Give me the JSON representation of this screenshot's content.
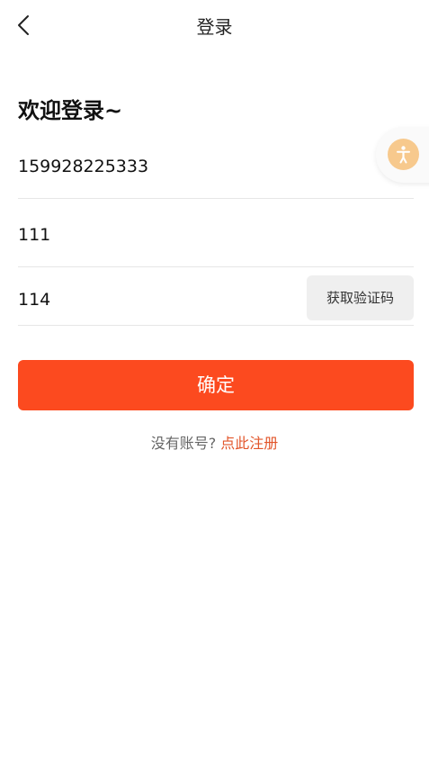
{
  "header": {
    "title": "登录"
  },
  "welcome_text": "欢迎登录~",
  "form": {
    "phone_value": "159928225333",
    "field2_value": "111",
    "code_value": "114",
    "get_code_label": "获取验证码"
  },
  "confirm_label": "确定",
  "register": {
    "prompt": "没有账号?",
    "link": "点此注册"
  },
  "colors": {
    "accent": "#fc4a1f",
    "link": "#e2552a",
    "float_button": "#f7c98d"
  },
  "icons": {
    "back": "chevron-left-icon",
    "float": "accessibility-icon"
  }
}
